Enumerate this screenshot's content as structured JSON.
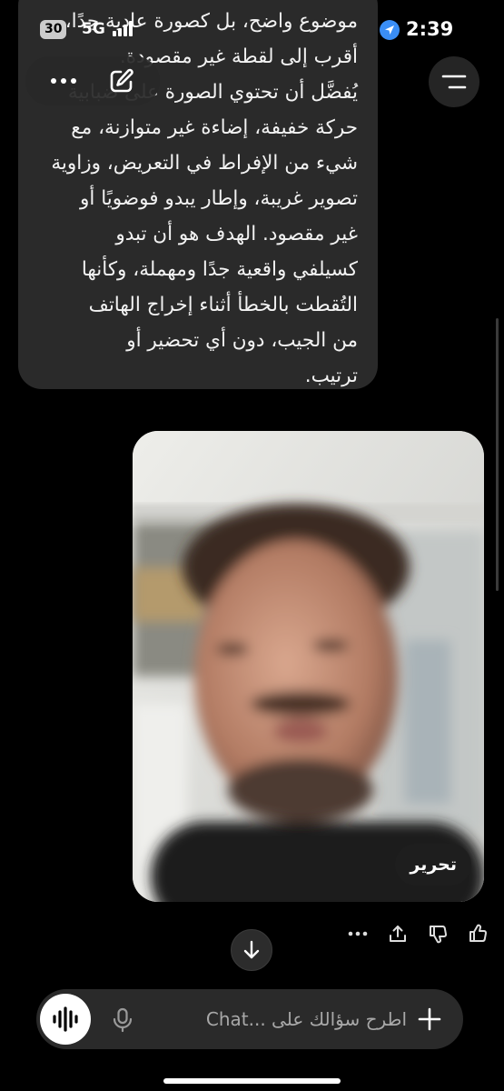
{
  "status_bar": {
    "notification_count": "30",
    "network": "5G",
    "time": "2:39",
    "location_icon": "location-arrow-icon"
  },
  "message": {
    "lines": [
      "موضوع واضح، بل كصورة عادية جدًا،",
      "أقرب إلى لقطة غير مقصودة.",
      "يُفضَّل أن تحتوي الصورة على ضبابية",
      "حركة خفيفة، إضاءة غير متوازنة، مع",
      "شيء من الإفراط في التعريض، وزاوية",
      "تصوير غريبة، وإطار يبدو فوضويًا أو",
      "غير مقصود. الهدف هو أن تبدو",
      "كسيلفي واقعية جدًا ومهملة، وكأنها",
      "التُقطت بالخطأ أثناء إخراج الهاتف",
      "من الجيب، دون أي تحضير أو",
      "ترتيب."
    ]
  },
  "photo": {
    "edit_label": "تحرير"
  },
  "composer": {
    "placeholder": "اطرح سؤالك على ...Chat"
  },
  "colors": {
    "background": "#000000",
    "bubble": "#2a2a2a",
    "composer": "#2a2a2a",
    "location_blue": "#3a8ef6"
  }
}
